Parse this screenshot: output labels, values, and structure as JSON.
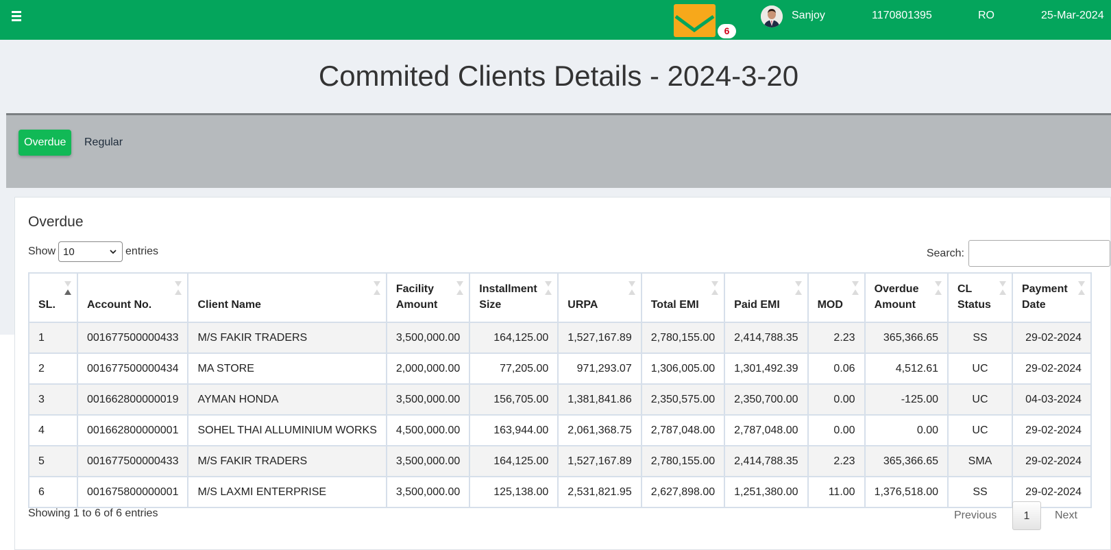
{
  "topbar": {
    "mail_count": "6",
    "user_name": "Sanjoy",
    "user_id": "1170801395",
    "role": "RO",
    "date": "25-Mar-2024"
  },
  "page": {
    "title": "Commited Clients Details - 2024-3-20"
  },
  "tabs": [
    {
      "label": "Overdue",
      "active": true
    },
    {
      "label": "Regular",
      "active": false
    }
  ],
  "card": {
    "title": "Overdue",
    "show_label": "Show",
    "entries_value": "10",
    "entries_label": "entries",
    "search_label": "Search:",
    "search_value": ""
  },
  "table": {
    "columns": [
      "SL.",
      "Account No.",
      "Client Name",
      "Facility Amount",
      "Installment Size",
      "URPA",
      "Total EMI",
      "Paid EMI",
      "MOD",
      "Overdue Amount",
      "CL Status",
      "Payment Date"
    ],
    "rows": [
      [
        "1",
        "001677500000433",
        "M/S FAKIR TRADERS",
        "3,500,000.00",
        "164,125.00",
        "1,527,167.89",
        "2,780,155.00",
        "2,414,788.35",
        "2.23",
        "365,366.65",
        "SS",
        "29-02-2024"
      ],
      [
        "2",
        "001677500000434",
        "MA STORE",
        "2,000,000.00",
        "77,205.00",
        "971,293.07",
        "1,306,005.00",
        "1,301,492.39",
        "0.06",
        "4,512.61",
        "UC",
        "29-02-2024"
      ],
      [
        "3",
        "001662800000019",
        "AYMAN HONDA",
        "3,500,000.00",
        "156,705.00",
        "1,381,841.86",
        "2,350,575.00",
        "2,350,700.00",
        "0.00",
        "-125.00",
        "UC",
        "04-03-2024"
      ],
      [
        "4",
        "001662800000001",
        "SOHEL THAI ALLUMINIUM WORKS",
        "4,500,000.00",
        "163,944.00",
        "2,061,368.75",
        "2,787,048.00",
        "2,787,048.00",
        "0.00",
        "0.00",
        "UC",
        "29-02-2024"
      ],
      [
        "5",
        "001677500000433",
        "M/S FAKIR TRADERS",
        "3,500,000.00",
        "164,125.00",
        "1,527,167.89",
        "2,780,155.00",
        "2,414,788.35",
        "2.23",
        "365,366.65",
        "SMA",
        "29-02-2024"
      ],
      [
        "6",
        "001675800000001",
        "M/S LAXMI ENTERPRISE",
        "3,500,000.00",
        "125,138.00",
        "2,531,821.95",
        "2,627,898.00",
        "1,251,380.00",
        "11.00",
        "1,376,518.00",
        "SS",
        "29-02-2024"
      ]
    ]
  },
  "footer": {
    "info": "Showing 1 to 6 of 6 entries",
    "previous": "Previous",
    "page": "1",
    "next": "Next"
  },
  "colors": {
    "topbar": "#04a55c",
    "active_tab": "#11b956",
    "mail": "#f7a81b"
  }
}
